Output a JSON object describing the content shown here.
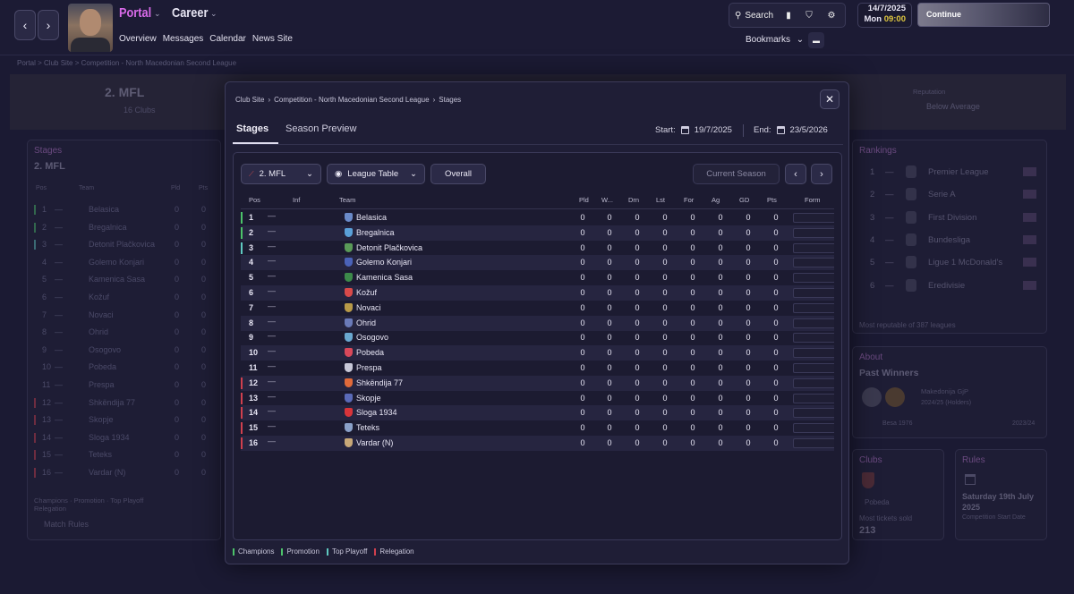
{
  "topbar": {
    "portal": "Portal",
    "career": "Career",
    "nav": [
      "Overview",
      "Messages",
      "Calendar",
      "News Site"
    ],
    "search": "Search",
    "date": "14/7/2025",
    "day": "Mon",
    "time": "09:00",
    "continue": "Continue",
    "bookmarks": "Bookmarks"
  },
  "background": {
    "breadcrumb": [
      "Portal",
      "Club Site",
      "Competition - North Macedonian Second League"
    ],
    "league_name": "2. MFL",
    "clubs": "16 Clubs",
    "reputation_label": "Reputation",
    "reputation_value": "Below Average",
    "stages_title": "Stages",
    "stages_sub": "2. MFL",
    "stages_cols": [
      "Pos",
      "Team",
      "Pld",
      "Pts"
    ],
    "rankings_title": "Rankings",
    "rankings": [
      {
        "pos": "1",
        "name": "Premier League"
      },
      {
        "pos": "2",
        "name": "Serie A"
      },
      {
        "pos": "3",
        "name": "First Division"
      },
      {
        "pos": "4",
        "name": "Bundesliga"
      },
      {
        "pos": "5",
        "name": "Ligue 1 McDonald's"
      },
      {
        "pos": "6",
        "name": "Eredivisie"
      }
    ],
    "rankings_note": "Most reputable of 387 leagues",
    "about_title": "About",
    "past_winners": "Past Winners",
    "winner1": "Makedonija GjP",
    "winner1_season": "2024/25 (Holders)",
    "winner2": "Besa 1976",
    "winner2_season": "2023/24",
    "clubs_title": "Clubs",
    "clubs_club": "Pobeda",
    "clubs_stat_label": "Most tickets sold",
    "clubs_stat_value": "213",
    "rules_title": "Rules",
    "rules_date": "Saturday 19th July 2025",
    "rules_date_label": "Competition Start Date",
    "legend": [
      "Champions",
      "Promotion",
      "Top Playoff",
      "Relegation"
    ],
    "match_rules": "Match Rules"
  },
  "modal": {
    "breadcrumb": [
      "Club Site",
      "Competition - North Macedonian Second League",
      "Stages"
    ],
    "tabs": [
      "Stages",
      "Season Preview"
    ],
    "start_label": "Start:",
    "start_date": "19/7/2025",
    "end_label": "End:",
    "end_date": "23/5/2026",
    "competition": "2. MFL",
    "view": "League Table",
    "filter": "Overall",
    "season": "Current Season",
    "columns": [
      "Pos",
      "Inf",
      "Team",
      "Pld",
      "W...",
      "Drn",
      "Lst",
      "For",
      "Ag",
      "GD",
      "Pts",
      "Form"
    ],
    "legend": [
      "Champions",
      "Promotion",
      "Top Playoff",
      "Relegation"
    ],
    "colors": {
      "champions": "#4cc36a",
      "promotion": "#4cc36a",
      "playoff": "#5fc9c0",
      "relegation": "#d0404e"
    },
    "rows": [
      {
        "pos": "1",
        "team": "Belasica",
        "zone": "champions",
        "crest": "#6a8ac8",
        "stats": [
          "0",
          "0",
          "0",
          "0",
          "0",
          "0",
          "0",
          "0"
        ]
      },
      {
        "pos": "2",
        "team": "Bregalnica",
        "zone": "promotion",
        "crest": "#5aa0d8",
        "stats": [
          "0",
          "0",
          "0",
          "0",
          "0",
          "0",
          "0",
          "0"
        ]
      },
      {
        "pos": "3",
        "team": "Detonit Plačkovica",
        "zone": "playoff",
        "crest": "#5a9a58",
        "stats": [
          "0",
          "0",
          "0",
          "0",
          "0",
          "0",
          "0",
          "0"
        ]
      },
      {
        "pos": "4",
        "team": "Golemo Konjari",
        "zone": "",
        "crest": "#4a62b8",
        "stats": [
          "0",
          "0",
          "0",
          "0",
          "0",
          "0",
          "0",
          "0"
        ]
      },
      {
        "pos": "5",
        "team": "Kamenica Sasa",
        "zone": "",
        "crest": "#3c8a4a",
        "stats": [
          "0",
          "0",
          "0",
          "0",
          "0",
          "0",
          "0",
          "0"
        ]
      },
      {
        "pos": "6",
        "team": "Kožuf",
        "zone": "",
        "crest": "#d84a4a",
        "stats": [
          "0",
          "0",
          "0",
          "0",
          "0",
          "0",
          "0",
          "0"
        ]
      },
      {
        "pos": "7",
        "team": "Novaci",
        "zone": "",
        "crest": "#b89a48",
        "stats": [
          "0",
          "0",
          "0",
          "0",
          "0",
          "0",
          "0",
          "0"
        ]
      },
      {
        "pos": "8",
        "team": "Ohrid",
        "zone": "",
        "crest": "#6a7ab8",
        "stats": [
          "0",
          "0",
          "0",
          "0",
          "0",
          "0",
          "0",
          "0"
        ]
      },
      {
        "pos": "9",
        "team": "Osogovo",
        "zone": "",
        "crest": "#6aa8d0",
        "stats": [
          "0",
          "0",
          "0",
          "0",
          "0",
          "0",
          "0",
          "0"
        ]
      },
      {
        "pos": "10",
        "team": "Pobeda",
        "zone": "",
        "crest": "#d8485a",
        "stats": [
          "0",
          "0",
          "0",
          "0",
          "0",
          "0",
          "0",
          "0"
        ]
      },
      {
        "pos": "11",
        "team": "Prespa",
        "zone": "",
        "crest": "#c8c8d8",
        "stats": [
          "0",
          "0",
          "0",
          "0",
          "0",
          "0",
          "0",
          "0"
        ]
      },
      {
        "pos": "12",
        "team": "Shkëndija 77",
        "zone": "relegation",
        "crest": "#e06a3a",
        "stats": [
          "0",
          "0",
          "0",
          "0",
          "0",
          "0",
          "0",
          "0"
        ]
      },
      {
        "pos": "13",
        "team": "Skopje",
        "zone": "relegation",
        "crest": "#5a6ab8",
        "stats": [
          "0",
          "0",
          "0",
          "0",
          "0",
          "0",
          "0",
          "0"
        ]
      },
      {
        "pos": "14",
        "team": "Sloga 1934",
        "zone": "relegation",
        "crest": "#d8343a",
        "stats": [
          "0",
          "0",
          "0",
          "0",
          "0",
          "0",
          "0",
          "0"
        ]
      },
      {
        "pos": "15",
        "team": "Teteks",
        "zone": "relegation",
        "crest": "#8aa0c8",
        "stats": [
          "0",
          "0",
          "0",
          "0",
          "0",
          "0",
          "0",
          "0"
        ]
      },
      {
        "pos": "16",
        "team": "Vardar (N)",
        "zone": "relegation",
        "crest": "#c8a878",
        "stats": [
          "0",
          "0",
          "0",
          "0",
          "0",
          "0",
          "0",
          "0"
        ]
      }
    ]
  }
}
